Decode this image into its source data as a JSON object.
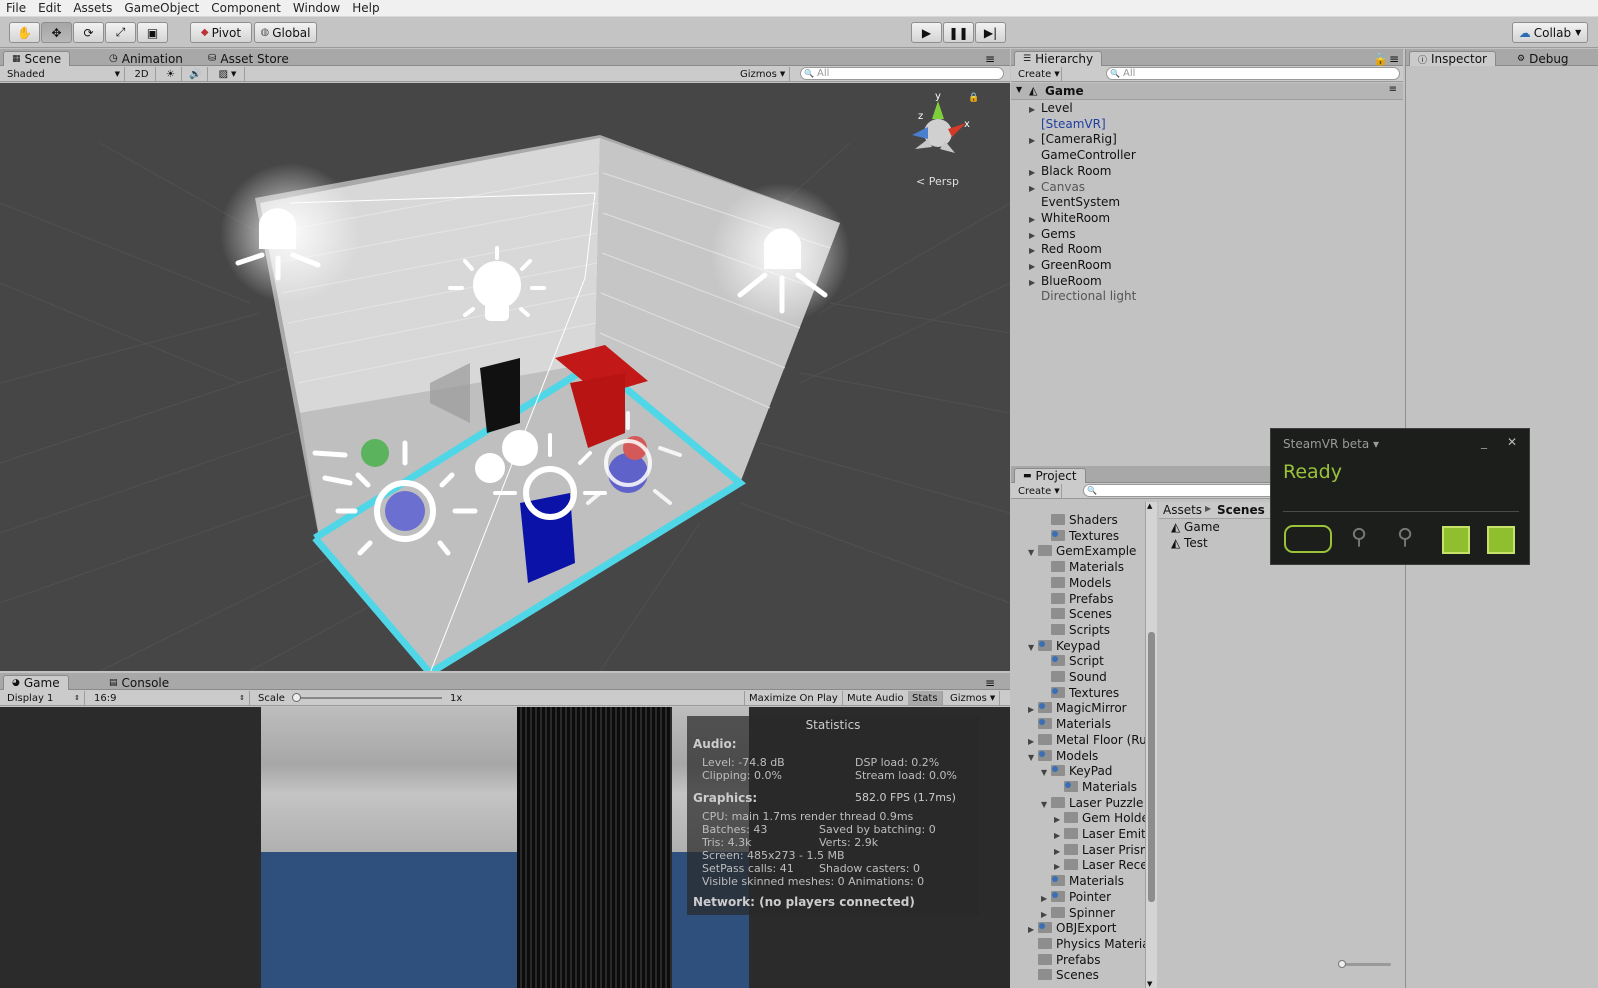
{
  "menu": [
    "File",
    "Edit",
    "Assets",
    "GameObject",
    "Component",
    "Window",
    "Help"
  ],
  "toolbar": {
    "pivot": "Pivot",
    "global": "Global",
    "collab": "Collab"
  },
  "scene_tabs": {
    "scene": "Scene",
    "animation": "Animation",
    "asset_store": "Asset Store"
  },
  "scene_bar": {
    "shading": "Shaded",
    "mode2d": "2D",
    "gizmos": "Gizmos",
    "search_placeholder": "All"
  },
  "scene_view": {
    "persp": "Persp"
  },
  "hierarchy": {
    "title": "Hierarchy",
    "create": "Create",
    "search_placeholder": "All",
    "scene": "Game",
    "items": [
      {
        "label": "Level",
        "arrow": true,
        "color": "#111111"
      },
      {
        "label": "[SteamVR]",
        "arrow": false,
        "color": "#1f3fa0"
      },
      {
        "label": "[CameraRig]",
        "arrow": true,
        "color": "#111111"
      },
      {
        "label": "GameController",
        "arrow": false,
        "color": "#111111"
      },
      {
        "label": "Black Room",
        "arrow": true,
        "color": "#111111"
      },
      {
        "label": "Canvas",
        "arrow": true,
        "color": "#555555"
      },
      {
        "label": "EventSystem",
        "arrow": false,
        "color": "#111111"
      },
      {
        "label": "WhiteRoom",
        "arrow": true,
        "color": "#111111"
      },
      {
        "label": "Gems",
        "arrow": true,
        "color": "#111111"
      },
      {
        "label": "Red Room",
        "arrow": true,
        "color": "#111111"
      },
      {
        "label": "GreenRoom",
        "arrow": true,
        "color": "#111111"
      },
      {
        "label": "BlueRoom",
        "arrow": true,
        "color": "#111111"
      },
      {
        "label": "Directional light",
        "arrow": false,
        "color": "#555555"
      }
    ]
  },
  "inspector": {
    "title": "Inspector",
    "debug": "Debug"
  },
  "project": {
    "title": "Project",
    "create": "Create",
    "tree": [
      {
        "label": "Shaders",
        "indent": 2,
        "arrow": "",
        "pkg": false
      },
      {
        "label": "Textures",
        "indent": 2,
        "arrow": "",
        "pkg": true
      },
      {
        "label": "GemExample",
        "indent": 1,
        "arrow": "▼",
        "pkg": false
      },
      {
        "label": "Materials",
        "indent": 2,
        "arrow": "",
        "pkg": false
      },
      {
        "label": "Models",
        "indent": 2,
        "arrow": "",
        "pkg": false
      },
      {
        "label": "Prefabs",
        "indent": 2,
        "arrow": "",
        "pkg": false
      },
      {
        "label": "Scenes",
        "indent": 2,
        "arrow": "",
        "pkg": false
      },
      {
        "label": "Scripts",
        "indent": 2,
        "arrow": "",
        "pkg": false
      },
      {
        "label": "Keypad",
        "indent": 1,
        "arrow": "▼",
        "pkg": true
      },
      {
        "label": "Script",
        "indent": 2,
        "arrow": "",
        "pkg": true
      },
      {
        "label": "Sound",
        "indent": 2,
        "arrow": "",
        "pkg": false
      },
      {
        "label": "Textures",
        "indent": 2,
        "arrow": "",
        "pkg": true
      },
      {
        "label": "MagicMirror",
        "indent": 1,
        "arrow": "▶",
        "pkg": true
      },
      {
        "label": "Materials",
        "indent": 1,
        "arrow": "",
        "pkg": true
      },
      {
        "label": "Metal Floor (Rust",
        "indent": 1,
        "arrow": "▶",
        "pkg": false
      },
      {
        "label": "Models",
        "indent": 1,
        "arrow": "▼",
        "pkg": true
      },
      {
        "label": "KeyPad",
        "indent": 2,
        "arrow": "▼",
        "pkg": true
      },
      {
        "label": "Materials",
        "indent": 3,
        "arrow": "",
        "pkg": true
      },
      {
        "label": "Laser Puzzle",
        "indent": 2,
        "arrow": "▼",
        "pkg": false
      },
      {
        "label": "Gem Holder",
        "indent": 3,
        "arrow": "▶",
        "pkg": false
      },
      {
        "label": "Laser Emitter",
        "indent": 3,
        "arrow": "▶",
        "pkg": false
      },
      {
        "label": "Laser Prism",
        "indent": 3,
        "arrow": "▶",
        "pkg": false
      },
      {
        "label": "Laser Receiv",
        "indent": 3,
        "arrow": "▶",
        "pkg": false
      },
      {
        "label": "Materials",
        "indent": 2,
        "arrow": "",
        "pkg": true
      },
      {
        "label": "Pointer",
        "indent": 2,
        "arrow": "▶",
        "pkg": true
      },
      {
        "label": "Spinner",
        "indent": 2,
        "arrow": "▶",
        "pkg": false
      },
      {
        "label": "OBJExport",
        "indent": 1,
        "arrow": "▶",
        "pkg": true
      },
      {
        "label": "Physics Materials",
        "indent": 1,
        "arrow": "",
        "pkg": false
      },
      {
        "label": "Prefabs",
        "indent": 1,
        "arrow": "",
        "pkg": false
      },
      {
        "label": "Scenes",
        "indent": 1,
        "arrow": "",
        "pkg": false
      }
    ],
    "breadcrumb": [
      "Assets",
      "Scenes"
    ],
    "files": [
      "Game",
      "Test"
    ]
  },
  "game_tabs": {
    "game": "Game",
    "console": "Console"
  },
  "game_bar": {
    "display": "Display 1",
    "aspect": "16:9",
    "scale_label": "Scale",
    "scale_value": "1x",
    "maximize": "Maximize On Play",
    "mute": "Mute Audio",
    "stats": "Stats",
    "gizmos": "Gizmos"
  },
  "statistics": {
    "title": "Statistics",
    "audio_heading": "Audio:",
    "level": "Level: -74.8 dB",
    "dsp": "DSP load: 0.2%",
    "clipping": "Clipping: 0.0%",
    "stream": "Stream load: 0.0%",
    "graphics_heading": "Graphics:",
    "fps": "582.0 FPS (1.7ms)",
    "cpu": "CPU: main 1.7ms  render thread 0.9ms",
    "batches": "Batches: 43",
    "saved": "Saved by batching: 0",
    "tris": "Tris: 4.3k",
    "verts": "Verts: 2.9k",
    "screen": "Screen: 485x273 - 1.5 MB",
    "setpass": "SetPass calls: 41",
    "shadow": "Shadow casters: 0",
    "skinned": "Visible skinned meshes: 0  Animations: 0",
    "network": "Network: (no players connected)"
  },
  "steamvr": {
    "title": "SteamVR beta ▾",
    "status": "Ready",
    "accent": "#9bc33a"
  },
  "icons": [
    "hand-icon",
    "move-icon",
    "rotate-icon",
    "scale-icon",
    "rect-icon",
    "play-icon",
    "pause-icon",
    "step-icon",
    "cloud-icon",
    "light-icon",
    "speaker-icon"
  ]
}
